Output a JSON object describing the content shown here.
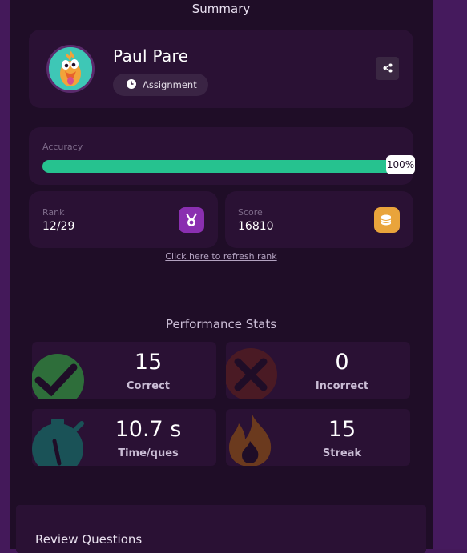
{
  "page": {
    "title": "Summary"
  },
  "profile": {
    "name": "Paul Pare",
    "mode_label": "Assignment",
    "avatar_icon": "duck-avatar-icon",
    "share_icon": "share-icon"
  },
  "accuracy": {
    "label": "Accuracy",
    "percent_text": "100%",
    "fraction": 1.0,
    "color": "#26c28f"
  },
  "rank": {
    "label": "Rank",
    "value": "12/29",
    "icon": "medal-icon",
    "color": "#8a2fb0"
  },
  "score": {
    "label": "Score",
    "value": "16810",
    "icon": "coins-icon",
    "color": "#e9a43b"
  },
  "refresh_link": "Click here to refresh rank",
  "performance": {
    "title": "Performance Stats",
    "items": [
      {
        "value": "15",
        "label": "Correct",
        "icon": "checkmark-icon"
      },
      {
        "value": "0",
        "label": "Incorrect",
        "icon": "cross-icon"
      },
      {
        "value": "10.7 s",
        "label": "Time/ques",
        "icon": "stopwatch-icon"
      },
      {
        "value": "15",
        "label": "Streak",
        "icon": "flame-icon"
      }
    ]
  },
  "review": {
    "title": "Review Questions"
  }
}
